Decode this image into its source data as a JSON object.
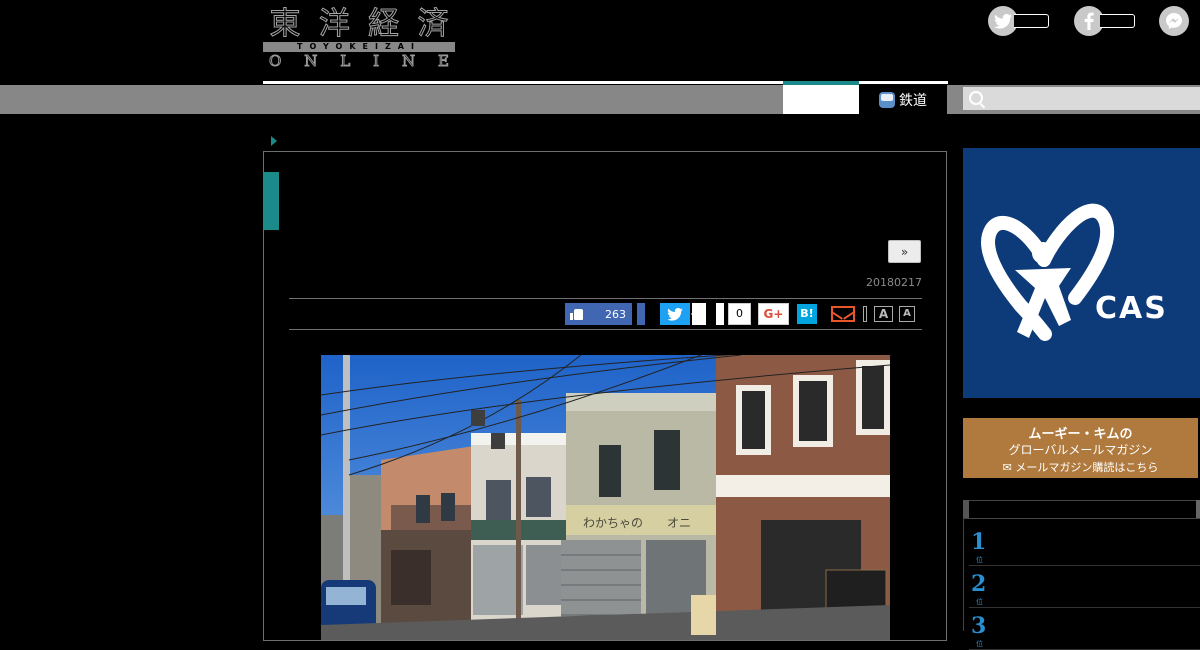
{
  "header": {
    "logo_kanji": [
      "東",
      "洋",
      "経",
      "済"
    ],
    "logo_romaji": "TOYOKEIZAI",
    "logo_online": [
      "O",
      "N",
      "L",
      "I",
      "N",
      "E"
    ]
  },
  "nav": {
    "category": "鉄道"
  },
  "article": {
    "next_label": "»",
    "date": "20180217",
    "fb_like_count": "263",
    "hatena_count": "0",
    "gplus_label": "G+",
    "hatena_label": "B!",
    "font_large": "A",
    "font_small": "A"
  },
  "ads": {
    "cas_brand": "CAS",
    "cas_registered": "®",
    "mag_line1": "ムーギー・キムの",
    "mag_line2": "グローバルメールマガジン",
    "mag_line3": "✉ メールマガジン購読はこちら"
  },
  "ranking": {
    "items": [
      {
        "rank": "1",
        "unit": "位"
      },
      {
        "rank": "2",
        "unit": "位"
      },
      {
        "rank": "3",
        "unit": "位"
      }
    ]
  },
  "photo": {
    "shop_sign": "わかちゃの",
    "shop_sign2": "オニ"
  },
  "colors": {
    "accent": "#1b8a8a",
    "facebook": "#4267b2",
    "twitter": "#1da1f2",
    "hatena": "#00a4de",
    "cas_bg": "#0d3a78"
  }
}
